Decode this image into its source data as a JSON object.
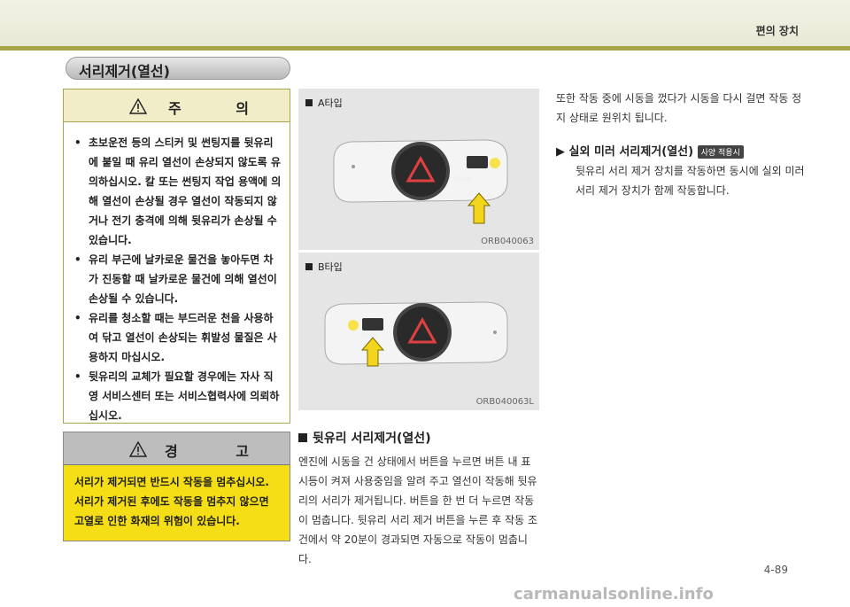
{
  "header": {
    "section": "편의 장치"
  },
  "title": "서리제거(열선)",
  "caution": {
    "heading": "주 의",
    "items": [
      "초보운전 등의 스티커 및 썬팅지를 뒷유리에 붙일 때 유리 열선이 손상되지 않도록 유의하십시오. 칼 또는 썬팅지 작업 용액에 의해 열선이 손상될 경우 열선이 작동되지 않거나 전기 충격에 의해 뒷유리가 손상될 수 있습니다.",
      "유리 부근에 날카로운 물건을 놓아두면 차가 진동할 때 날카로운 물건에 의해 열선이 손상될 수 있습니다.",
      "유리를 청소할 때는 부드러운 천을 사용하여 닦고 열선이 손상되는 휘발성 물질은 사용하지 마십시오.",
      "뒷유리의 교체가 필요할 경우에는 자사 직영 서비스센터 또는 서비스협력사에 의뢰하십시오."
    ]
  },
  "warning": {
    "heading": "경 고",
    "text": "서리가 제거되면 반드시 작동을 멈추십시오. 서리가 제거된 후에도 작동을 멈추지 않으면 고열로 인한 화재의 위험이 있습니다."
  },
  "figures": [
    {
      "label": "A타입",
      "code": "ORB040063"
    },
    {
      "label": "B타입",
      "code": "ORB040063L"
    }
  ],
  "button_text": "REAR",
  "rear_defrost": {
    "heading": "뒷유리 서리제거(열선)",
    "text": "엔진에 시동을 건 상태에서 버튼을 누르면 버튼 내 표시등이 켜져 사용중임을 알려 주고 열선이 작동해 뒷유리의 서리가 제거됩니다. 버튼을 한 번 더 누르면 작동이 멈춥니다. 뒷유리 서리 제거 버튼을 누른 후 작동 조건에서 약 20분이 경과되면 자동으로 작동이 멈춥니다."
  },
  "right": {
    "intro": "또한 작동 중에 시동을 껐다가 시동을 다시 걸면 작동 정지 상태로 원위치 됩니다.",
    "mirror_heading": "실외 미러 서리제거(열선)",
    "option_badge": "사양 적용시",
    "mirror_text": "뒷유리 서리 제거 장치를 작동하면 동시에 실외 미러 서리 제거 장치가 함께 작동합니다."
  },
  "page_number": "4-89",
  "watermark": "carmanualsonline.info"
}
